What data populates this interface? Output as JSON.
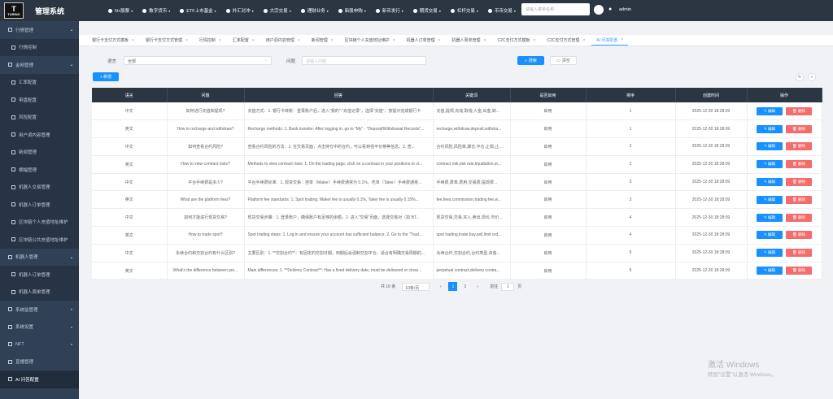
{
  "logo": {
    "main": "T",
    "sub": "TURING"
  },
  "app_title": "管理系统",
  "topnav": [
    {
      "label": "N+股票",
      "has_caret": true
    },
    {
      "label": "数字货币",
      "has_caret": true
    },
    {
      "label": "ETF上市基金",
      "has_caret": true
    },
    {
      "label": "外汇对冲",
      "has_caret": true
    },
    {
      "label": "大宗交易",
      "has_caret": true
    },
    {
      "label": "理财业务",
      "has_caret": true
    },
    {
      "label": "新股申购",
      "has_caret": true
    },
    {
      "label": "新币发行",
      "has_caret": true
    },
    {
      "label": "期货交易",
      "has_caret": true
    },
    {
      "label": "杠杆交易",
      "has_caret": true
    },
    {
      "label": "币币交易",
      "has_caret": true
    }
  ],
  "top_search_placeholder": "请输入菜单名称",
  "username": "admin",
  "sidebar": [
    {
      "label": "行情管理",
      "type": "group",
      "arrow": "▴"
    },
    {
      "label": "行情控制",
      "type": "sub"
    },
    {
      "label": "金网管理",
      "type": "group",
      "arrow": "▴"
    },
    {
      "label": "汇率配置",
      "type": "sub"
    },
    {
      "label": "带盘配置",
      "type": "sub"
    },
    {
      "label": "风险配置",
      "type": "sub"
    },
    {
      "label": "用户调内容管理",
      "type": "sub"
    },
    {
      "label": "新闻管理",
      "type": "sub"
    },
    {
      "label": "横幅管理",
      "type": "sub"
    },
    {
      "label": "机器人交易管理",
      "type": "sub"
    },
    {
      "label": "机器人订单管理",
      "type": "sub"
    },
    {
      "label": "区块链个人充值地址维护",
      "type": "sub"
    },
    {
      "label": "区块链公共充值地址维护",
      "type": "sub"
    },
    {
      "label": "机器人管理",
      "type": "group",
      "arrow": "▴"
    },
    {
      "label": "机器人订单管理",
      "type": "sub"
    },
    {
      "label": "机器人周单管理",
      "type": "sub"
    },
    {
      "label": "系统监管理",
      "type": "group",
      "arrow": "▾"
    },
    {
      "label": "系统设置",
      "type": "group",
      "arrow": "▾"
    },
    {
      "label": "NFT",
      "type": "group",
      "arrow": "▾"
    },
    {
      "label": "直播管理",
      "type": "group",
      "arrow": ""
    },
    {
      "label": "AI 问答配置",
      "type": "group",
      "arrow": "",
      "active": true
    }
  ],
  "tabs": [
    {
      "label": "银行卡支付方式模板"
    },
    {
      "label": "银行卡支付方式管理"
    },
    {
      "label": "行情控制"
    },
    {
      "label": "汇率配置"
    },
    {
      "label": "用户调内容管理"
    },
    {
      "label": "新闻管理"
    },
    {
      "label": "区块链个人充值地址维护"
    },
    {
      "label": "机器人订单管理"
    },
    {
      "label": "机器人周单管理"
    },
    {
      "label": "C2C支付方式模板"
    },
    {
      "label": "C2C支付方式管理"
    },
    {
      "label": "AI 问答配置",
      "active": true
    }
  ],
  "filter": {
    "lang_label": "语言",
    "lang_value": "全部",
    "question_label": "问题",
    "question_placeholder": "请输入问题",
    "search_label": "搜索",
    "reset_label": "清空",
    "add_label": "+ 新增"
  },
  "table": {
    "headers": [
      "语言",
      "问题",
      "回答",
      "关键词",
      "是否启用",
      "排序",
      "创建时间",
      "操作"
    ],
    "edit_label": "✎ 编辑",
    "delete_label": "🗑 删除",
    "rows": [
      {
        "lang": "中文",
        "q": "如何进行充值和提现?",
        "a": "充值方式：1. 银行卡转账：登录账户后，进入\"我的\"-\"充值记录\"，选择\"充值\"，按提示完成银行卡",
        "kw": "充值,提现,充钱,取钱,入金,出金,转...",
        "enabled": "启用",
        "sort": "1",
        "time": "2025-12-30 18:28:09"
      },
      {
        "lang": "英文",
        "q": "How to recharge and withdraw?",
        "a": "Recharge methods: 1. Bank transfer: After logging in, go to \"My\" - \"Deposit/Withdrawal Records\"...",
        "kw": "recharge,withdraw,deposit,withdra...",
        "enabled": "启用",
        "sort": "1",
        "time": "2025-12-30 18:28:09"
      },
      {
        "lang": "中文",
        "q": "如何查看合约风险?",
        "a": "查看合约风险的方法：1. 在交易页面，点击持仓中的合约，可以看到强平价格等信息。2. 查...",
        "kw": "合约风险,风险率,爆仓,平仓,止损,止盈...",
        "enabled": "启用",
        "sort": "2",
        "time": "2025-12-30 18:28:09"
      },
      {
        "lang": "英文",
        "q": "How to view contract risks?",
        "a": "Methods to view contract risks: 1. On the trading page, click on a contract in your positions to vi...",
        "kw": "contract risk,risk rate,liquidation,st...",
        "enabled": "启用",
        "sort": "2",
        "time": "2025-12-30 18:28:09"
      },
      {
        "lang": "中文",
        "q": "平台手续费是多少?",
        "a": "平台手续费标准：1. 现货交易：挂单（Maker）手续费通常为 0.1%，吃单（Taker）手续费通常...",
        "kw": "手续费,费率,费用,交易费,提现费...",
        "enabled": "启用",
        "sort": "3",
        "time": "2025-12-30 18:28:09"
      },
      {
        "lang": "英文",
        "q": "What are the platform fees?",
        "a": "Platform fee standards: 1. Spot trading: Maker fee is usually 0.1%, Taker fee is usually 0.15%...",
        "kw": "fee,fees,commission,trading fee,w...",
        "enabled": "启用",
        "sort": "3",
        "time": "2025-12-30 18:28:09"
      },
      {
        "lang": "中文",
        "q": "如何才能进行现货交易?",
        "a": "现货交易步骤：1. 登录账户，确保账户有足够的余额。2. 进入\"交易\"页面，选择交易对（如 BT...",
        "kw": "现货交易,交易,买入,卖出,现价,市价...",
        "enabled": "启用",
        "sort": "4",
        "time": "2025-12-30 18:28:09"
      },
      {
        "lang": "英文",
        "q": "How to trade spot?",
        "a": "Spot trading steps: 1. Log in and ensure your account has sufficient balance. 2. Go to the \"Trad...",
        "kw": "spot trading,trade,buy,sell,limit ord...",
        "enabled": "启用",
        "sort": "4",
        "time": "2025-12-30 18:28:09"
      },
      {
        "lang": "中文",
        "q": "永续合约和交割合约有什么区别?",
        "a": "主要区别：1. **交割合约**：有固定的交割日期，到期后会强制交割平仓。适合有明确交易周期的...",
        "kw": "永续合约,交割合约,合约类型,资金...",
        "enabled": "启用",
        "sort": "5",
        "time": "2025-12-30 18:28:09"
      },
      {
        "lang": "英文",
        "q": "What's the difference between per...",
        "a": "Main differences: 1. **Delivery Contract**: Has a fixed delivery date, must be delivered or close...",
        "kw": "perpetual contract,delivery contra...",
        "enabled": "启用",
        "sort": "5",
        "time": "2025-12-30 18:28:09"
      }
    ]
  },
  "pager": {
    "total": "共 16 条",
    "size": "10条/页",
    "prev": "‹",
    "pages": [
      "1",
      "2"
    ],
    "next": "›",
    "goto_label": "前往",
    "goto_value": "1",
    "page_suffix": "页"
  },
  "watermark": {
    "line1": "激活 Windows",
    "line2": "转到\"设置\"以激活 Windows。"
  }
}
